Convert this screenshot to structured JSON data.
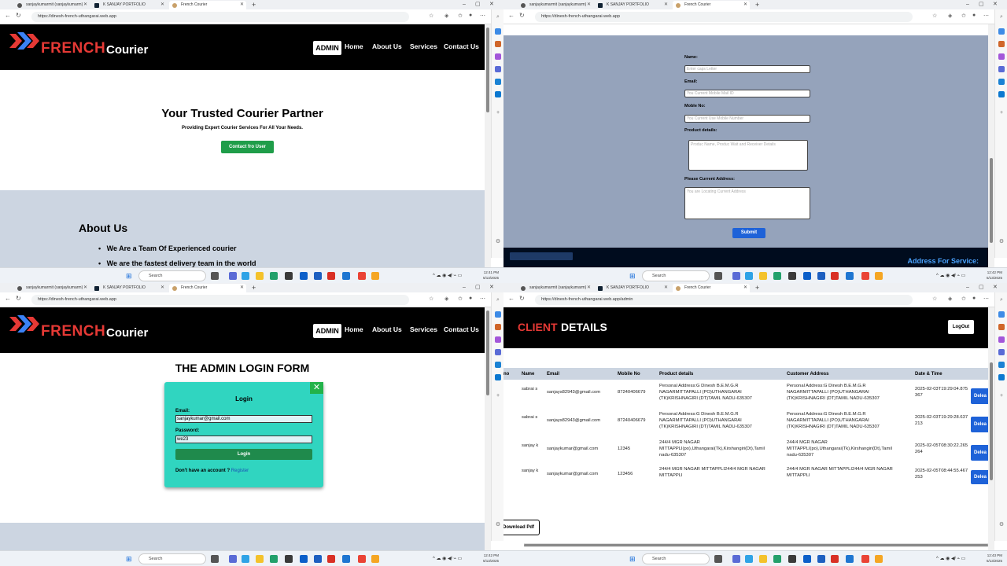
{
  "colors": {
    "brand_red": "#e53935",
    "header_bg": "#000000",
    "green": "#1f9d49",
    "teal": "#30d5c0",
    "blue": "#1e62d8"
  },
  "browser": {
    "tabs": [
      "sanjaykumarmit (sanjaykumarm)",
      "K SANJAY PORTFOLIO",
      "French Courier"
    ],
    "url_home": "https://dinesh-french-uthangarai.web.app",
    "url_admin": "https://dinesh-french-uthangarai.web.app/admin"
  },
  "taskbar": {
    "search": "Search",
    "time_1": "12:41 PM",
    "date_1": "5/13/2025",
    "time_2": "12:42 PM",
    "date_2": "5/13/2025",
    "time_3": "12:42 PM",
    "date_3": "5/13/2025",
    "time_4": "12:43 PM",
    "date_4": "5/13/2025"
  },
  "site": {
    "brand": "FRENCH",
    "brand2": "Courier",
    "admin": "ADMIN",
    "nav": [
      "Home",
      "About Us",
      "Services",
      "Contact Us"
    ]
  },
  "home": {
    "title": "Your Trusted Courier Partner",
    "subtitle": "Providing Expert Courier Services For All Your Needs.",
    "cta": "Contact fro User",
    "about_title": "About Us",
    "about_items": [
      "We Are a Team Of Experienced courier",
      "We are the fastest delivery team in the world"
    ]
  },
  "contact_form": {
    "name_label": "Name:",
    "name_ph": "Enter caps Letter",
    "email_label": "Email:",
    "email_ph": "You Current Mobile Mail ID",
    "mobile_label": "Moble No:",
    "mobile_ph": "You Current Use Mobile Number",
    "product_label": "Product details:",
    "product_ph": "Produc Name, Produc Wait and Receiver Details",
    "address_label": "Please Current Address:",
    "address_ph": "You are Locating Current Address",
    "submit": "Submit",
    "footer_right": "Address For Service:"
  },
  "login": {
    "page_title": "THE ADMIN LOGIN FORM",
    "box_title": "Login",
    "email_label": "Email:",
    "email_value": "sanjaykumar@gmail.com",
    "password_label": "Password:",
    "password_value": "we23",
    "button": "Login",
    "no_account": "Don't have an account ?",
    "register": "Register"
  },
  "admin": {
    "title_red": "CLIENT",
    "title_white": "DETAILS",
    "logout": "LogOut",
    "download": "Download Pdf",
    "columns": [
      "no",
      "Name",
      "Email",
      "Mobile No",
      "Product details",
      "Customer Address",
      "Date & Time"
    ],
    "delete_label": "Delea",
    "rows": [
      {
        "name": "sabrai s",
        "email": "sanjays82943@gmail.com",
        "mobile": "87240406679",
        "product": "Personal Address:G Dinesh B.E.M.G.R NAGARMITTAPALLI (PO)UTHANGARAI (TK)KRISHNAGIRI (DT)TAMIL NADU-635307",
        "address": "Personal Address:G Dinesh B.E.M.G.R NAGARMITTAPALLI (PO)UTHANGARAI (TK)KRISHNAGIRI (DT)TAMIL NADU-635307",
        "date": "2025-02-03T19:29:04.875367"
      },
      {
        "name": "sabrai s",
        "email": "sanjays82943@gmail.com",
        "mobile": "87240406679",
        "product": "Personal Address:G Dinesh B.E.M.G.R NAGARMITTAPALLI (PO)UTHANGARAI (TK)KRISHNAGIRI (DT)TAMIL NADU-635307",
        "address": "Personal Address:G Dinesh B.E.M.G.R NAGARMITTAPALLI (PO)UTHANGARAI (TK)KRISHNAGIRI (DT)TAMIL NADU-635307",
        "date": "2025-02-03T19:29:28.637213"
      },
      {
        "name": "sanjay k",
        "email": "sanjaykumar@gmail.com",
        "mobile": "12345",
        "product": "244/4 MGR NAGAR MITTAPPLI(po),Uthangarai(Tk),Kirshangiri(Dt),Tamil nadu-635307",
        "address": "244/4 MGR NAGAR MITTAPPLI(po),Uthangarai(Tk),Kirshangiri(Dt),Tamil nadu-635307",
        "date": "2025-02-05T08:30:22.265264"
      },
      {
        "name": "sanjay k",
        "email": "sanjaykumar@gmail.com",
        "mobile": "123456",
        "product": "244/4 MGR NAGAR MITTAPPLI244/4 MGR NAGAR MITTAPPLI",
        "address": "244/4 MGR NAGAR MITTAPPLI244/4 MGR NAGAR MITTAPPLI",
        "date": "2025-02-05T08:44:55.467253"
      }
    ]
  }
}
